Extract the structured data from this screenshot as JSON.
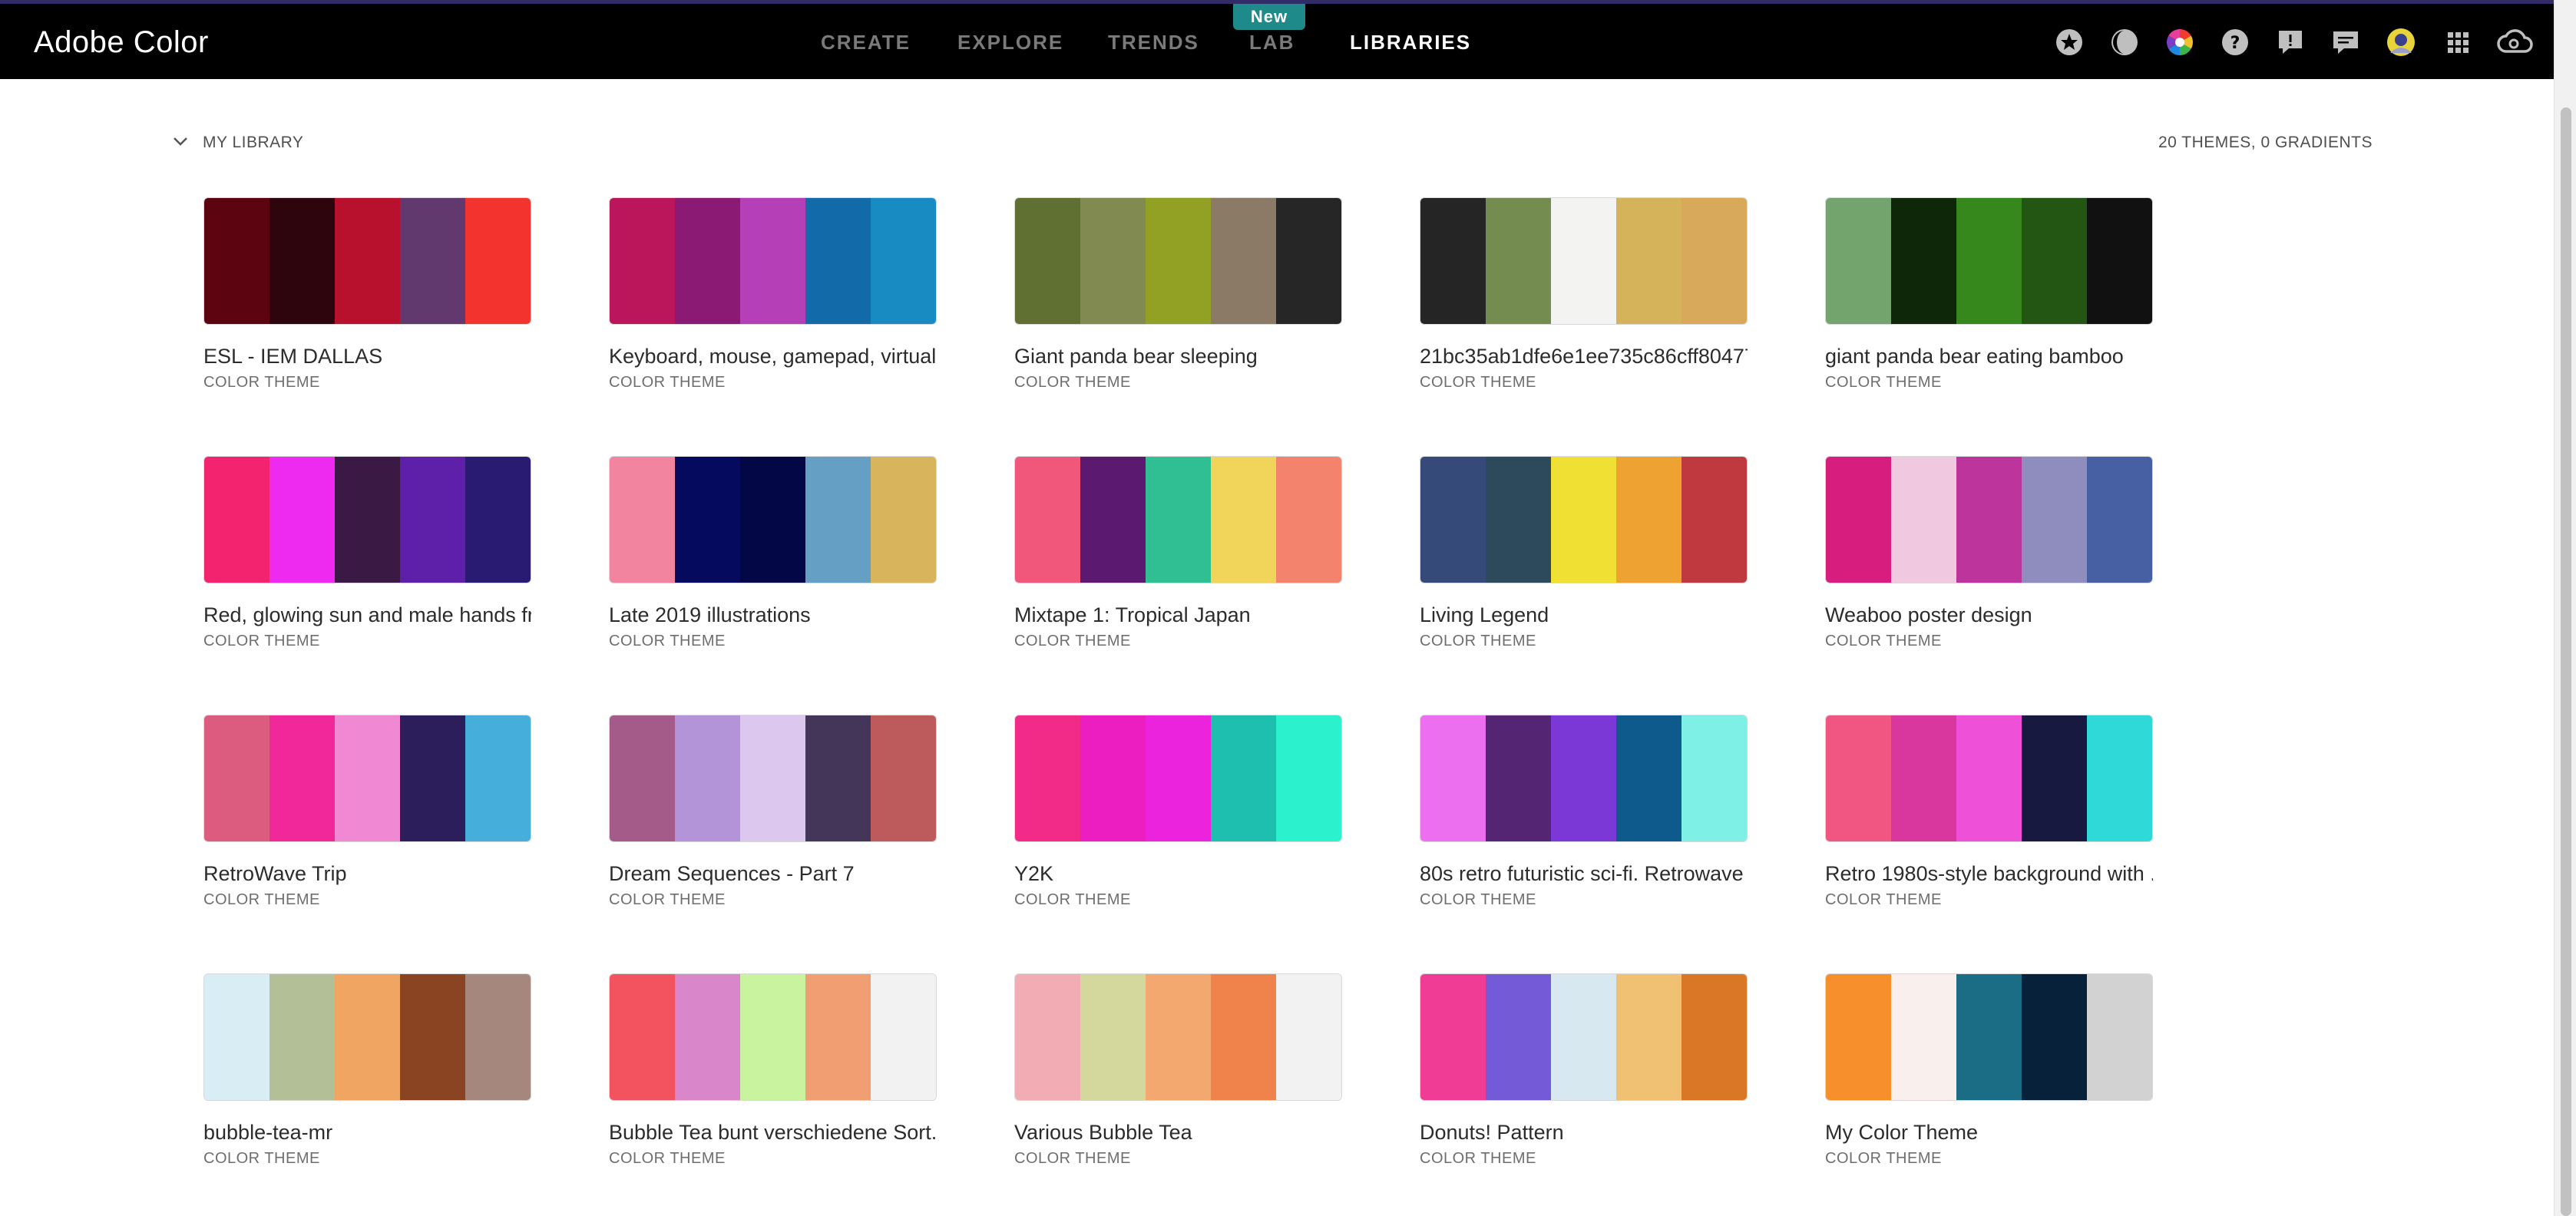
{
  "header": {
    "brand": "Adobe Color",
    "nav": [
      {
        "label": "CREATE",
        "active": false
      },
      {
        "label": "EXPLORE",
        "active": false
      },
      {
        "label": "TRENDS",
        "active": false
      },
      {
        "label": "LAB",
        "active": false
      },
      {
        "label": "LIBRARIES",
        "active": true
      }
    ],
    "new_badge": "New",
    "icons": [
      "star-icon",
      "contrast-icon",
      "color-wheel-icon",
      "help-icon",
      "feedback-icon",
      "chat-icon",
      "avatar",
      "apps-grid-icon",
      "creative-cloud-icon"
    ]
  },
  "library": {
    "title": "MY LIBRARY",
    "count": "20 THEMES, 0 GRADIENTS"
  },
  "themes": [
    {
      "name": "ESL - IEM DALLAS",
      "type": "COLOR THEME",
      "colors": [
        "#5c0510",
        "#2e050c",
        "#b8112d",
        "#62396e",
        "#f2332e"
      ]
    },
    {
      "name": "Keyboard, mouse, gamepad, virtual...",
      "type": "COLOR THEME",
      "colors": [
        "#bb155b",
        "#8a1a74",
        "#b43fb6",
        "#136aa9",
        "#188bc3"
      ]
    },
    {
      "name": "Giant panda bear sleeping",
      "type": "COLOR THEME",
      "colors": [
        "#607033",
        "#818a50",
        "#92a123",
        "#8b7a66",
        "#262626"
      ]
    },
    {
      "name": "21bc35ab1dfe6e1ee735c86cff80477...",
      "type": "COLOR THEME",
      "colors": [
        "#252525",
        "#748c4f",
        "#f3f3f1",
        "#d5b35a",
        "#d9a95b"
      ]
    },
    {
      "name": "giant panda bear eating bamboo",
      "type": "COLOR THEME",
      "colors": [
        "#74a46e",
        "#0e2709",
        "#37881c",
        "#245613",
        "#111111"
      ]
    },
    {
      "name": "Red, glowing sun and male hands fr...",
      "type": "COLOR THEME",
      "colors": [
        "#f3236f",
        "#ee29f0",
        "#3a1945",
        "#5f20a9",
        "#281b71"
      ]
    },
    {
      "name": "Late 2019 illustrations",
      "type": "COLOR THEME",
      "colors": [
        "#f2849f",
        "#050a5f",
        "#040745",
        "#659fc3",
        "#d8b55c"
      ]
    },
    {
      "name": "Mixtape 1: Tropical Japan",
      "type": "COLOR THEME",
      "colors": [
        "#f0577a",
        "#5b1a70",
        "#30bf93",
        "#f1d45a",
        "#f3836c"
      ]
    },
    {
      "name": "Living Legend",
      "type": "COLOR THEME",
      "colors": [
        "#354a78",
        "#2c4a5c",
        "#f0e033",
        "#eea232",
        "#bf393f"
      ]
    },
    {
      "name": "Weaboo poster design",
      "type": "COLOR THEME",
      "colors": [
        "#d71d7e",
        "#f0c9e1",
        "#bd349d",
        "#8f8dbd",
        "#4760a4"
      ]
    },
    {
      "name": "RetroWave Trip",
      "type": "COLOR THEME",
      "colors": [
        "#db5c7e",
        "#f0289a",
        "#f088d4",
        "#2c1e5a",
        "#45aedb"
      ]
    },
    {
      "name": "Dream Sequences - Part 7",
      "type": "COLOR THEME",
      "colors": [
        "#a45b89",
        "#b394d8",
        "#dcc8ef",
        "#443659",
        "#bd5a5c"
      ]
    },
    {
      "name": "Y2K",
      "type": "COLOR THEME",
      "colors": [
        "#f12b87",
        "#ed1ec1",
        "#ec23dd",
        "#1ebfaf",
        "#2bf1cc"
      ]
    },
    {
      "name": "80s retro futuristic sci-fi. Retrowave ...",
      "type": "COLOR THEME",
      "colors": [
        "#ec6fef",
        "#532573",
        "#7b38d6",
        "#0e5a8c",
        "#7ff0e6"
      ]
    },
    {
      "name": "Retro 1980s-style background with ...",
      "type": "COLOR THEME",
      "colors": [
        "#f05681",
        "#d9369e",
        "#ee50d8",
        "#171941",
        "#2ed9d8"
      ]
    },
    {
      "name": "bubble-tea-mr",
      "type": "COLOR THEME",
      "colors": [
        "#d9edf5",
        "#b2bf97",
        "#f0a562",
        "#8b4421",
        "#a5877d"
      ]
    },
    {
      "name": "Bubble Tea bunt verschiedene Sort...",
      "type": "COLOR THEME",
      "colors": [
        "#f2535f",
        "#d986cb",
        "#c9f39e",
        "#f19e72",
        "#f2f2f2"
      ]
    },
    {
      "name": "Various Bubble Tea",
      "type": "COLOR THEME",
      "colors": [
        "#f2adb4",
        "#d4d89c",
        "#f2a86e",
        "#f0834b",
        "#f2f2f2"
      ]
    },
    {
      "name": "Donuts! Pattern",
      "type": "COLOR THEME",
      "colors": [
        "#f03c95",
        "#755ad7",
        "#d8e8f0",
        "#f0c173",
        "#d97726"
      ]
    },
    {
      "name": "My Color Theme",
      "type": "COLOR THEME",
      "colors": [
        "#f78f2d",
        "#f9efed",
        "#1b6d85",
        "#07213a",
        "#d2d2d2"
      ]
    }
  ]
}
